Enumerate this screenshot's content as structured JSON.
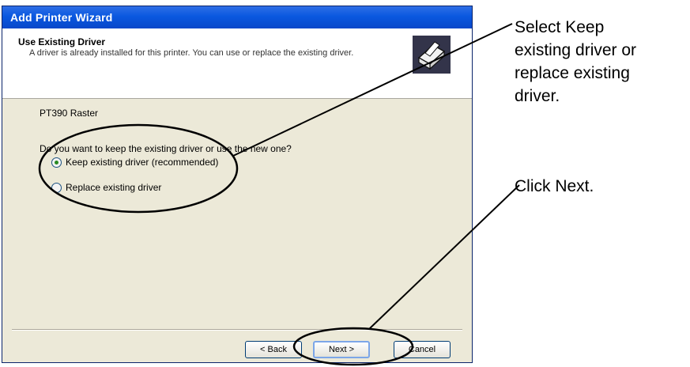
{
  "window": {
    "title": "Add Printer Wizard"
  },
  "header": {
    "title": "Use Existing Driver",
    "subtitle": "A driver is already installed for this printer. You can use or replace the existing driver."
  },
  "printer_name": "PT390 Raster",
  "question": "Do you want to keep the existing driver or use the new one?",
  "options": [
    {
      "label": "Keep existing driver (recommended)",
      "selected": true
    },
    {
      "label": "Replace existing driver",
      "selected": false
    }
  ],
  "buttons": {
    "back": "< Back",
    "next": "Next >",
    "cancel": "Cancel"
  },
  "annotations": {
    "select_lines": [
      "Select Keep",
      "existing driver or",
      "replace existing",
      "driver."
    ],
    "click_next": "Click Next."
  }
}
